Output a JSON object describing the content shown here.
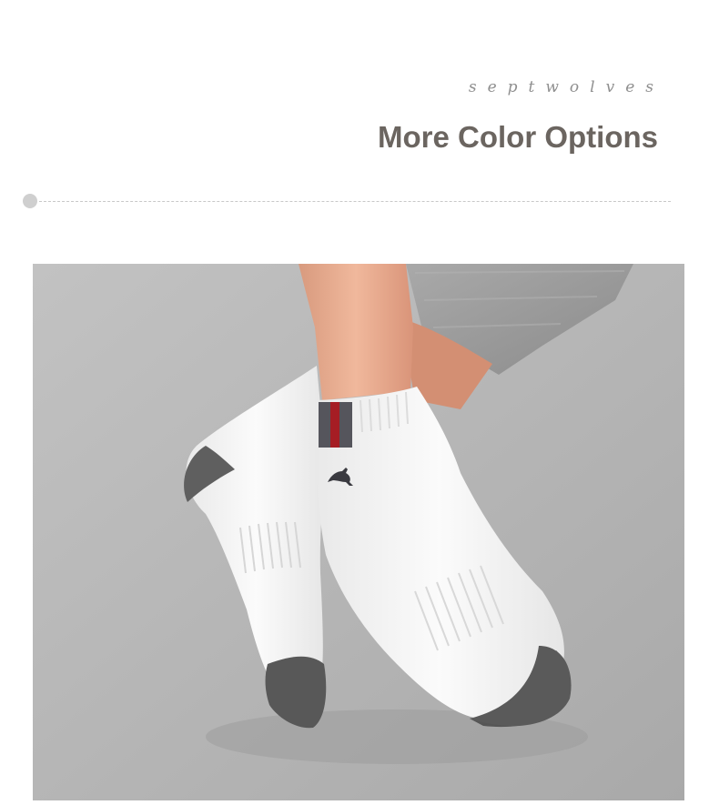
{
  "header": {
    "brand": "septwolves",
    "title": "More Color Options"
  },
  "photo": {
    "subject": "white ankle socks with gray heel and toe",
    "colors": {
      "background": "#b3b3b3",
      "sock": "#f4f4f4",
      "heel_toe": "#5c5c5c",
      "stripe_gray": "#55555c",
      "stripe_red": "#a51d24",
      "trousers": "#9c9c9c",
      "skin": "#e2a487"
    }
  }
}
